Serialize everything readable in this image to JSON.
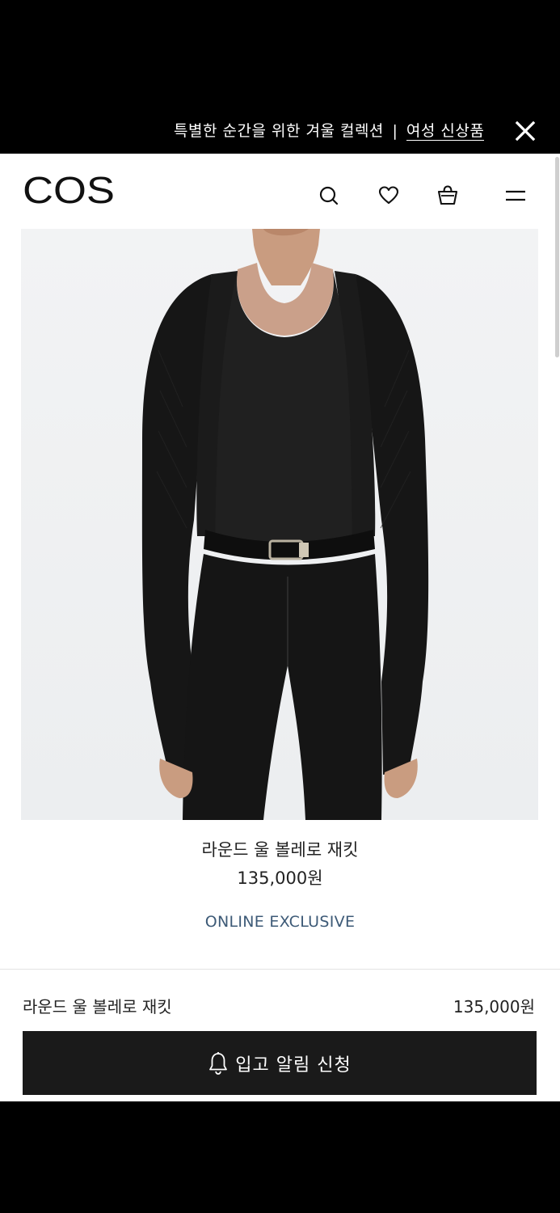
{
  "promo": {
    "text": "특별한 순간을 위한 겨울 컬렉션",
    "separator": "|",
    "link": "여성 신상품"
  },
  "header": {
    "logo": "COS",
    "icons": [
      "search-icon",
      "heart-icon",
      "bag-icon",
      "menu-icon"
    ]
  },
  "product": {
    "name": "라운드 울 볼레로 재킷",
    "price": "135,000원",
    "badge": "ONLINE EXCLUSIVE",
    "badge_color": "#3d5a77"
  },
  "sticky_bar": {
    "name": "라운드 울 볼레로 재킷",
    "price": "135,000원",
    "button_label": "입고 알림 신청",
    "button_color": "#1a1a1a"
  }
}
